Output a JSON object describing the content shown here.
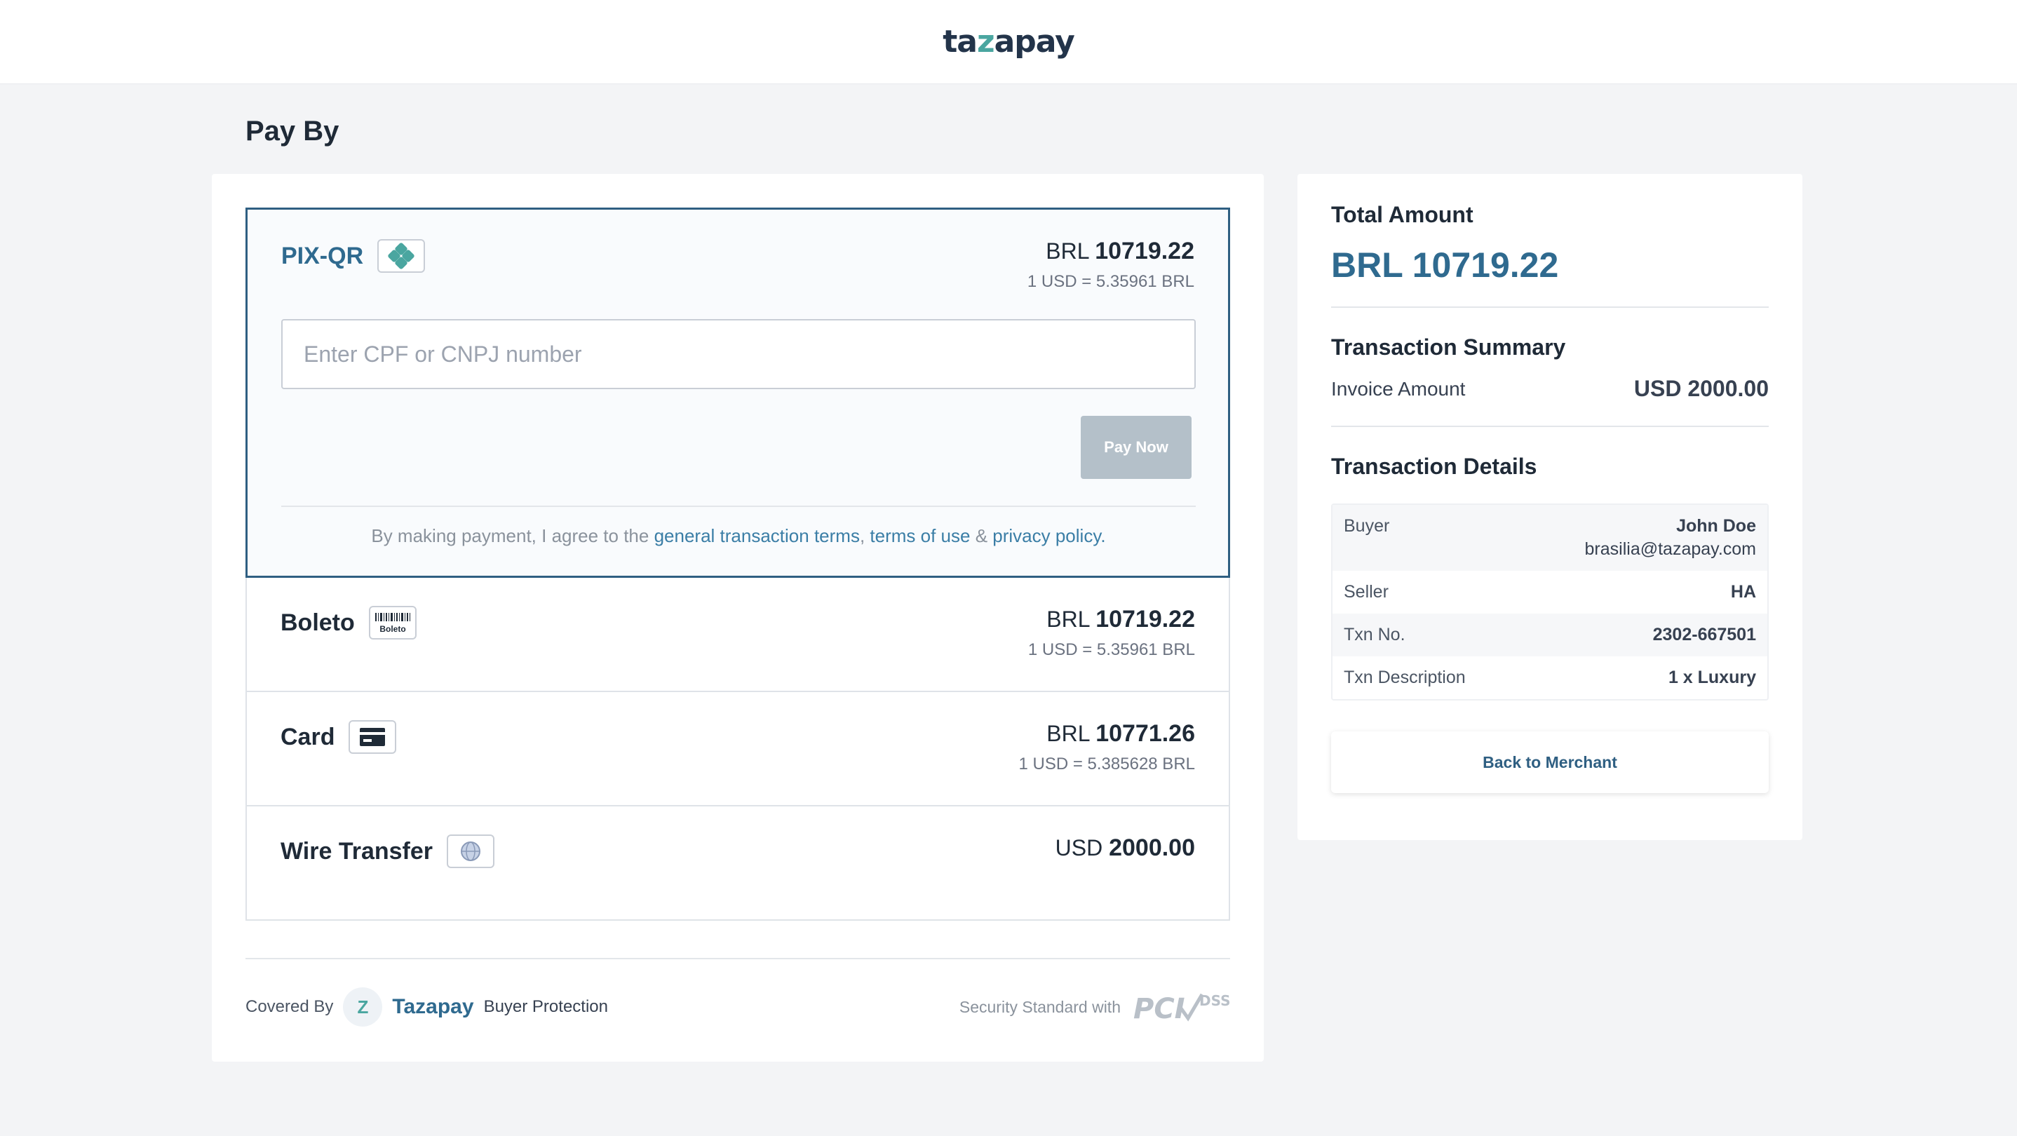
{
  "header": {
    "logo_pre": "ta",
    "logo_z": "z",
    "logo_post": "apay"
  },
  "page_title": "Pay By",
  "methods": [
    {
      "name": "PIX-QR",
      "icon": "pix-icon",
      "currency": "BRL",
      "amount": "10719.22",
      "rate": "1 USD = 5.35961 BRL",
      "input_placeholder": "Enter CPF or CNPJ number",
      "pay_label": "Pay Now",
      "terms_prefix": "By making payment, I agree to the ",
      "terms_link1": "general transaction terms",
      "terms_sep1": ", ",
      "terms_link2": "terms of use",
      "terms_sep2": " & ",
      "terms_link3": "privacy policy",
      "terms_end": "."
    },
    {
      "name": "Boleto",
      "icon": "barcode-icon",
      "icon_text": "Boleto",
      "currency": "BRL",
      "amount": "10719.22",
      "rate": "1 USD = 5.35961 BRL"
    },
    {
      "name": "Card",
      "icon": "card-icon",
      "currency": "BRL",
      "amount": "10771.26",
      "rate": "1 USD = 5.385628 BRL"
    },
    {
      "name": "Wire Transfer",
      "icon": "globe-icon",
      "currency": "USD",
      "amount": "2000.00",
      "rate": ""
    }
  ],
  "footer": {
    "covered_by": "Covered By",
    "badge_letter": "Z",
    "brand": "Tazapay",
    "protection": "Buyer Protection",
    "security": "Security Standard with",
    "pci_text": "PCI",
    "dss_text": "DSS"
  },
  "summary": {
    "total_label": "Total Amount",
    "total_value": "BRL 10719.22",
    "txn_summary_title": "Transaction Summary",
    "invoice_label": "Invoice Amount",
    "invoice_value": "USD 2000.00",
    "details_title": "Transaction Details",
    "details": [
      {
        "label": "Buyer",
        "value": "John Doe",
        "sub": "brasilia@tazapay.com"
      },
      {
        "label": "Seller",
        "value": "HA"
      },
      {
        "label": "Txn No.",
        "value": "2302-667501"
      },
      {
        "label": "Txn Description",
        "value": "1 x Luxury"
      }
    ],
    "back_label": "Back to Merchant"
  },
  "colors": {
    "accent": "#2f6a8f",
    "pix_green": "#4aa6a0",
    "disabled_button": "#b4c0c9"
  }
}
